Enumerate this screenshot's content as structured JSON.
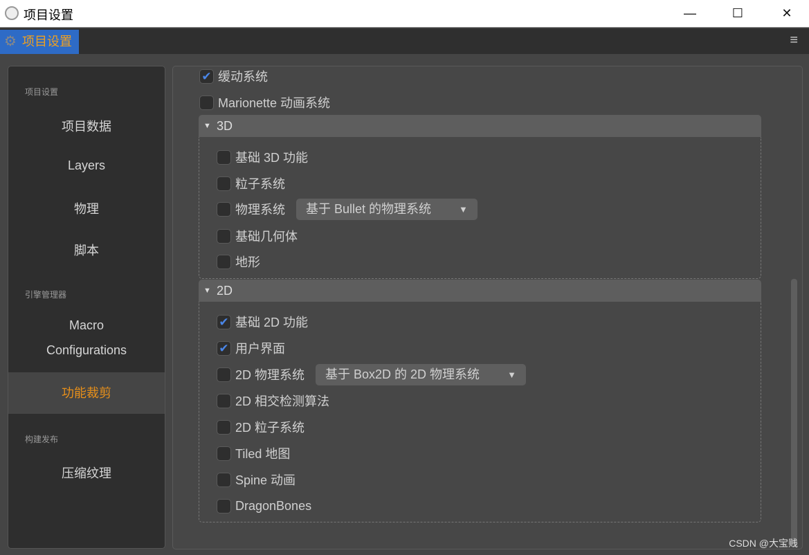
{
  "window": {
    "title": "项目设置",
    "minimize": "—",
    "maximize": "☐",
    "close": "✕"
  },
  "tab": {
    "label": "项目设置",
    "menu": "≡"
  },
  "sidebar": {
    "sections": [
      "项目设置",
      "引擎管理器",
      "构建发布"
    ],
    "items": [
      "项目数据",
      "Layers",
      "物理",
      "脚本",
      "Macro",
      "Configurations",
      "功能裁剪",
      "压缩纹理"
    ]
  },
  "main": {
    "top": [
      {
        "label": "缓动系统",
        "checked": true
      },
      {
        "label": "Marionette 动画系统",
        "checked": false
      }
    ],
    "group3d": {
      "title": "3D",
      "items": [
        {
          "label": "基础 3D 功能",
          "checked": false
        },
        {
          "label": "粒子系统",
          "checked": false
        },
        {
          "label": "物理系统",
          "checked": false,
          "select": "基于 Bullet 的物理系统"
        },
        {
          "label": "基础几何体",
          "checked": false
        },
        {
          "label": "地形",
          "checked": false
        }
      ]
    },
    "group2d": {
      "title": "2D",
      "items": [
        {
          "label": "基础 2D 功能",
          "checked": true
        },
        {
          "label": "用户界面",
          "checked": true
        },
        {
          "label": "2D 物理系统",
          "checked": false,
          "select": "基于 Box2D 的 2D 物理系统"
        },
        {
          "label": "2D 相交检测算法",
          "checked": false
        },
        {
          "label": "2D 粒子系统",
          "checked": false
        },
        {
          "label": "Tiled 地图",
          "checked": false
        },
        {
          "label": "Spine 动画",
          "checked": false
        },
        {
          "label": "DragonBones",
          "checked": false
        }
      ]
    }
  },
  "watermark": "CSDN @大宝贱",
  "colors": {
    "accent": "#2e6bc6",
    "active": "#e8901a",
    "check": "#4a86e8"
  }
}
